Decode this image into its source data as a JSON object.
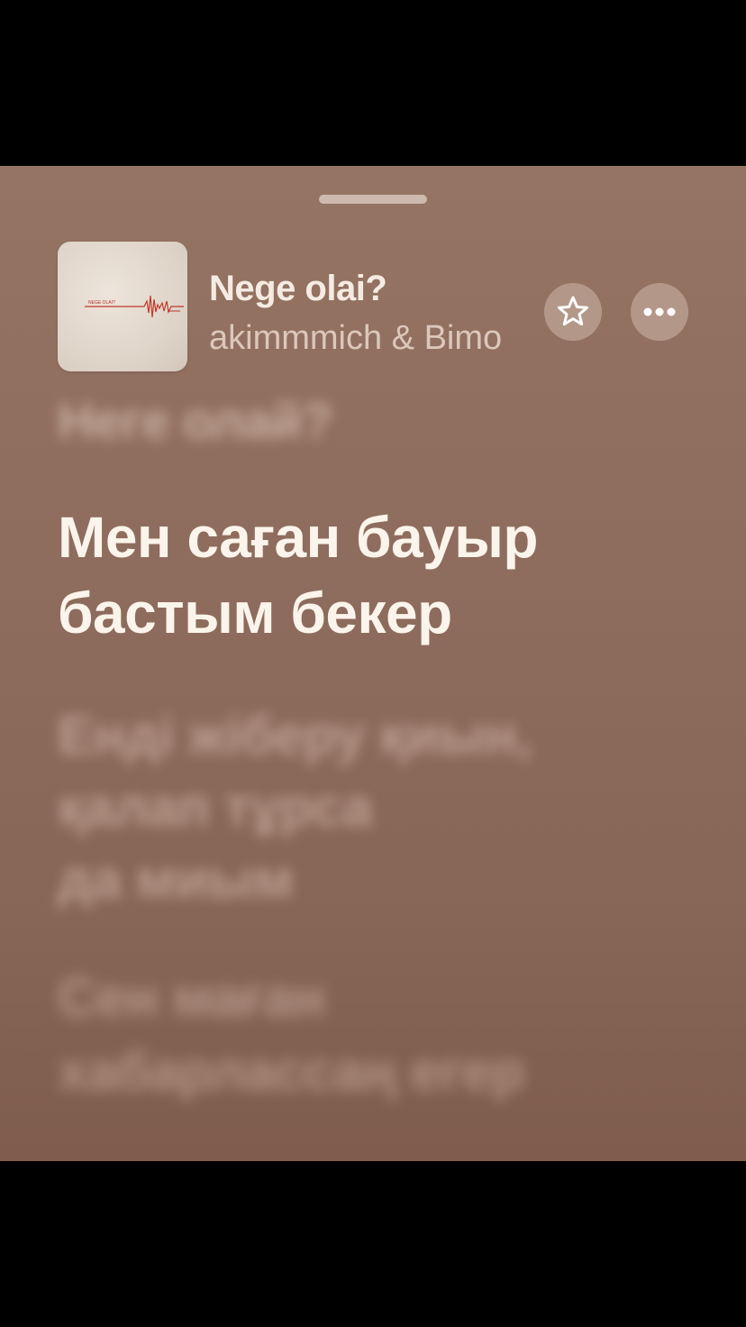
{
  "now_playing": {
    "title": "Nege olai?",
    "artist": "akimmmich & Bimo"
  },
  "artwork": {
    "cover_text": "NEGE OLAI?",
    "accent_color": "#c0392b"
  },
  "actions": {
    "favorite_icon": "star-outline-icon",
    "more_icon": "ellipsis-icon"
  },
  "lyrics": {
    "previous": "Неге олай?",
    "current": [
      "Мен саған бауыр",
      "бастым бекер"
    ],
    "upcoming_1": [
      "Енді жіберу қиын,",
      "қалап тұрса",
      "да миым"
    ],
    "upcoming_2": [
      "Сен маған",
      "хабарлассаң егер"
    ]
  },
  "colors": {
    "background": "#8e6c5e",
    "text_primary": "#fbf4ea",
    "text_secondary": "#dcc7bb"
  }
}
